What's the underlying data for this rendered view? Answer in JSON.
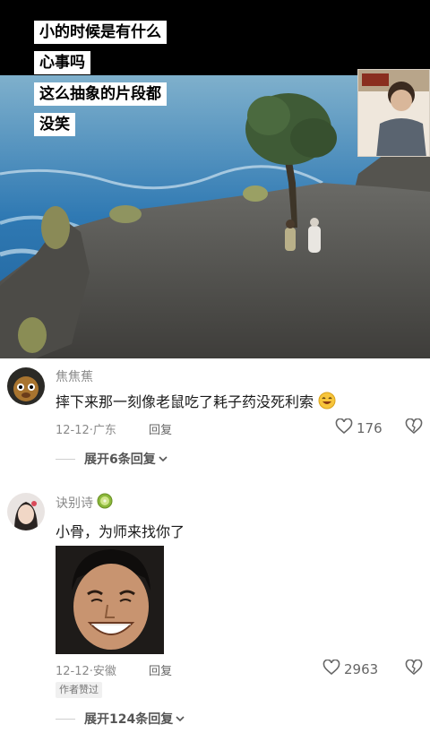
{
  "video": {
    "caption_lines": [
      "小的时候是有什么",
      "心事吗",
      "这么抽象的片段都",
      "没笑"
    ]
  },
  "comments": [
    {
      "username": "焦焦蕉",
      "text": "摔下来那一刻像老鼠吃了耗子药没死利索",
      "emoji_icon": "grinning-face-icon",
      "date": "12-12",
      "location": "广东",
      "reply_label": "回复",
      "likes": "176",
      "expand_label": "展开6条回复"
    },
    {
      "username": "诀别诗",
      "username_badge_icon": "kiwi-icon",
      "text": "小骨，为师来找你了",
      "date": "12-12",
      "location": "安徽",
      "reply_label": "回复",
      "likes": "2963",
      "author_badge": "作者赞过",
      "expand_label": "展开124条回复"
    }
  ],
  "colors": {
    "text_primary": "#1a1a1a",
    "text_secondary": "#8a8a8a",
    "caption_bg": "#ffffff"
  }
}
